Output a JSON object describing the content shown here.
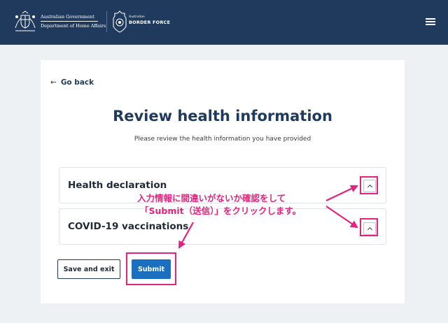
{
  "header": {
    "gov_line1": "Australian Government",
    "gov_line2": "Department of Home Affairs",
    "abf_small": "Australian",
    "abf_big": "BORDER FORCE",
    "menu_icon": "hamburger-menu-icon"
  },
  "nav": {
    "back_label": "Go back",
    "back_icon": "arrow-left-icon"
  },
  "page": {
    "title": "Review health information",
    "subtitle": "Please review the health information you have provided"
  },
  "sections": [
    {
      "title": "Health declaration",
      "toggle_icon": "chevron-up-icon"
    },
    {
      "title": "COVID-19 vaccinations",
      "toggle_icon": "chevron-up-icon"
    }
  ],
  "actions": {
    "secondary_label": "Save and exit",
    "primary_label": "Submit"
  },
  "annotation": {
    "line1": "入力情報に間違いがないか確認をして",
    "line2": "「Submit（送信）」をクリックします。",
    "color": "#e4237e"
  },
  "colors": {
    "header_bg": "#1f3a5d",
    "primary": "#1a6fbf",
    "page_bg": "#eef1f4"
  }
}
